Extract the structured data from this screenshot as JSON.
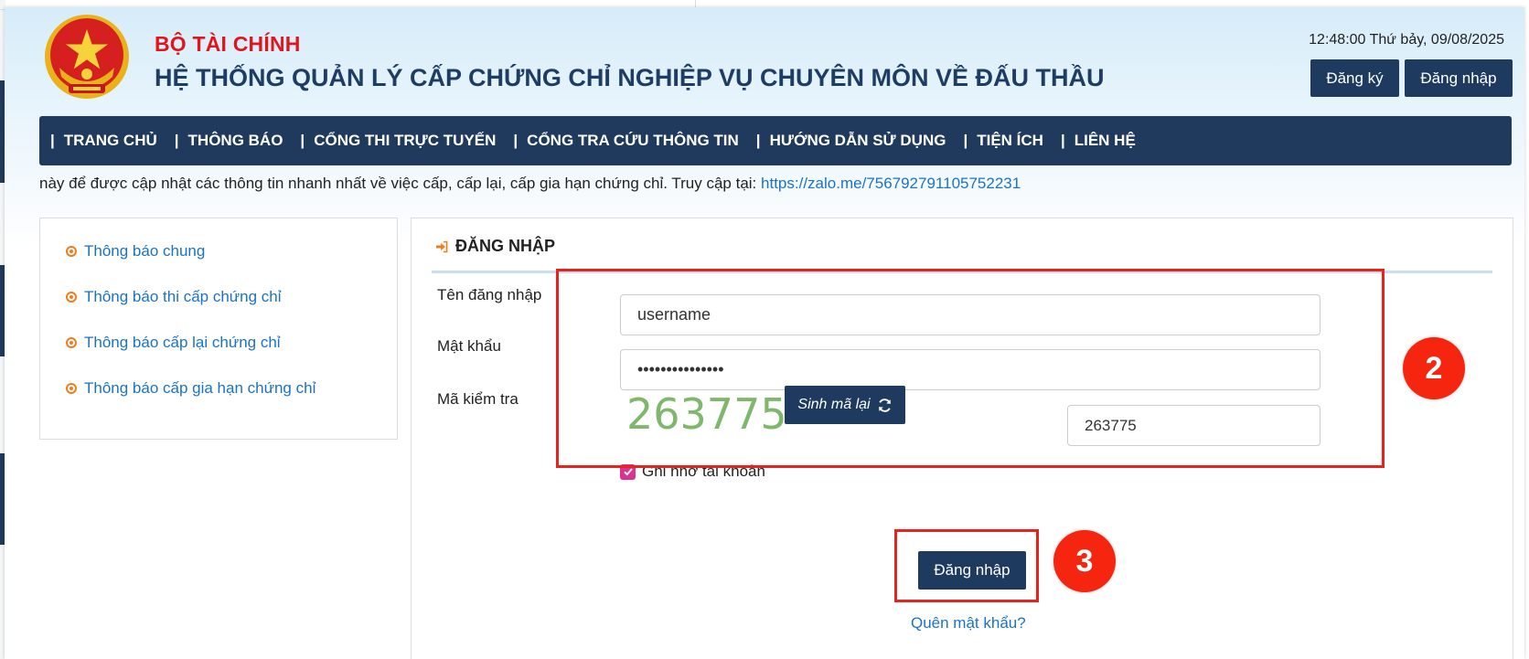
{
  "header": {
    "org_name": "BỘ TÀI CHÍNH",
    "system_title": "HỆ THỐNG QUẢN LÝ CẤP CHỨNG CHỈ NGHIỆP VỤ CHUYÊN MÔN VỀ ĐẤU THẦU",
    "datetime": "12:48:00 Thứ bảy, 09/08/2025",
    "register_label": "Đăng ký",
    "login_label": "Đăng nhập",
    "emblem_icon": "national-emblem-icon"
  },
  "nav": {
    "items": [
      {
        "label": "TRANG CHỦ"
      },
      {
        "label": "THÔNG BÁO"
      },
      {
        "label": "CỔNG THI TRỰC TUYẾN"
      },
      {
        "label": "CỔNG TRA CỨU THÔNG TIN"
      },
      {
        "label": "HƯỚNG DẪN SỬ DỤNG"
      },
      {
        "label": "TIỆN ÍCH"
      },
      {
        "label": "LIÊN HỆ"
      }
    ],
    "separator": "|"
  },
  "marquee": {
    "text": "này để được cập nhật các thông tin nhanh nhất về việc cấp, cấp lại, cấp gia hạn chứng chỉ. Truy cập tại: ",
    "link": "https://zalo.me/756792791105752231"
  },
  "sidebar": {
    "items": [
      {
        "label": "Thông báo chung"
      },
      {
        "label": "Thông báo thi cấp chứng chỉ"
      },
      {
        "label": "Thông báo cấp lại chứng chỉ"
      },
      {
        "label": "Thông báo cấp gia hạn chứng chỉ"
      }
    ]
  },
  "login_form": {
    "title": "ĐĂNG NHẬP",
    "username_label": "Tên đăng nhập",
    "username_value": "username",
    "password_label": "Mật khẩu",
    "password_value": "•••••••••••••••",
    "captcha_label": "Mã kiểm tra",
    "captcha_code": "263775",
    "regenerate_label": "Sinh mã lại",
    "captcha_input_value": "263775",
    "remember_label": "Ghi nhớ tài khoản",
    "remember_checked": true,
    "submit_label": "Đăng nhập",
    "forgot_label": "Quên mật khẩu?"
  },
  "annotations": {
    "step_2": "2",
    "step_3": "3",
    "highlight_color": "#e8231b"
  },
  "colors": {
    "navy": "#1e3a5f",
    "brand_red": "#e0161c",
    "link_blue": "#1a73c8",
    "captcha_green": "#7fb86c",
    "accent_orange": "#f07d1c"
  }
}
